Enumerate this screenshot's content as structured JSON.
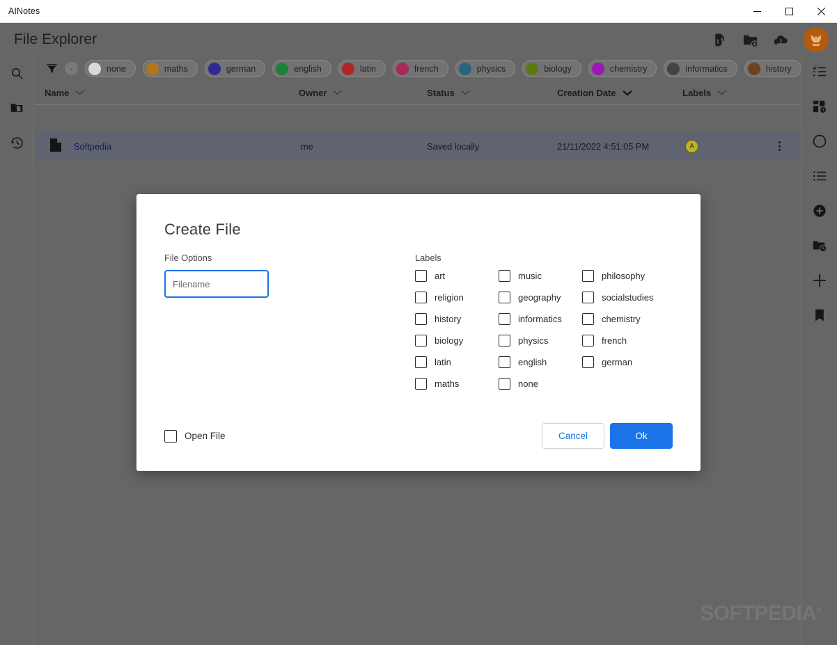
{
  "window": {
    "title": "AINotes",
    "controls": [
      {
        "name": "minimize",
        "glyph": "minimize-icon"
      },
      {
        "name": "maximize",
        "glyph": "maximize-icon"
      },
      {
        "name": "close",
        "glyph": "close-icon"
      }
    ]
  },
  "header": {
    "title": "File Explorer",
    "actions": [
      {
        "name": "new-file-icon",
        "label": "New File"
      },
      {
        "name": "new-folder-icon",
        "label": "New Folder"
      },
      {
        "name": "cloud-alert-icon",
        "label": "Cloud Status"
      }
    ],
    "avatar": {
      "name": "avatar",
      "icon": "cat-icon",
      "color": "#b35c10"
    }
  },
  "left_rail": {
    "items": [
      {
        "name": "search-icon",
        "label": "Search"
      },
      {
        "name": "folder-file-icon",
        "label": "Files"
      },
      {
        "name": "history-clock-icon",
        "label": "History"
      }
    ]
  },
  "right_rail": {
    "items": [
      {
        "name": "checklist-icon",
        "label": "Checklist"
      },
      {
        "name": "dashboard-clock-icon",
        "label": "Recent Boards"
      },
      {
        "name": "circle-icon",
        "label": "Circle"
      },
      {
        "name": "bullet-list-icon",
        "label": "List"
      },
      {
        "name": "add-circle-icon",
        "label": "Add"
      },
      {
        "name": "folder-clock-icon",
        "label": "Recent Folder"
      },
      {
        "name": "plus-icon",
        "label": "New"
      },
      {
        "name": "bookmark-icon",
        "label": "Bookmark"
      }
    ]
  },
  "filterbar": {
    "filter_icon": "filter-icon",
    "scroll_left": "‹",
    "scroll_right": "›",
    "chips": [
      {
        "label": "none",
        "color": "#d9d9d9"
      },
      {
        "label": "maths",
        "color": "#b5751f"
      },
      {
        "label": "german",
        "color": "#302a95"
      },
      {
        "label": "english",
        "color": "#1d8239"
      },
      {
        "label": "latin",
        "color": "#b02525"
      },
      {
        "label": "french",
        "color": "#a8285a"
      },
      {
        "label": "physics",
        "color": "#28647d"
      },
      {
        "label": "biology",
        "color": "#5d7a12"
      },
      {
        "label": "chemistry",
        "color": "#9c16b8"
      },
      {
        "label": "informatics",
        "color": "#3f4444"
      },
      {
        "label": "history",
        "color": "#6b4322"
      }
    ],
    "partial_chip": {
      "label": "",
      "color": "#8fb3c7"
    }
  },
  "table": {
    "columns": [
      {
        "key": "name",
        "label": "Name",
        "sortable": true,
        "active": false
      },
      {
        "key": "owner",
        "label": "Owner",
        "sortable": true,
        "active": false
      },
      {
        "key": "status",
        "label": "Status",
        "sortable": true,
        "active": false
      },
      {
        "key": "created",
        "label": "Creation Date",
        "sortable": true,
        "active": true
      },
      {
        "key": "labels",
        "label": "Labels",
        "sortable": true,
        "active": false
      }
    ],
    "rows": [
      {
        "icon": "file-icon",
        "name": "Softpedia",
        "owner": "me",
        "status": "Saved locally",
        "created": "21/11/2022 4:51:05 PM",
        "label_badge": "A",
        "label_badge_color": "#c2b429",
        "menu": "row-menu-icon"
      }
    ]
  },
  "dialog": {
    "title": "Create File",
    "file_options_label": "File Options",
    "filename_placeholder": "Filename",
    "filename_value": "",
    "labels_label": "Labels",
    "labels": [
      {
        "label": "art",
        "checked": false
      },
      {
        "label": "music",
        "checked": false
      },
      {
        "label": "philosophy",
        "checked": false
      },
      {
        "label": "religion",
        "checked": false
      },
      {
        "label": "geography",
        "checked": false
      },
      {
        "label": "socialstudies",
        "checked": false
      },
      {
        "label": "history",
        "checked": false
      },
      {
        "label": "informatics",
        "checked": false
      },
      {
        "label": "chemistry",
        "checked": false
      },
      {
        "label": "biology",
        "checked": false
      },
      {
        "label": "physics",
        "checked": false
      },
      {
        "label": "french",
        "checked": false
      },
      {
        "label": "latin",
        "checked": false
      },
      {
        "label": "english",
        "checked": false
      },
      {
        "label": "german",
        "checked": false
      },
      {
        "label": "maths",
        "checked": false
      },
      {
        "label": "none",
        "checked": false
      }
    ],
    "open_file_label": "Open File",
    "open_file_checked": false,
    "cancel_label": "Cancel",
    "ok_label": "Ok",
    "accent_color": "#1a73e8"
  },
  "watermark": {
    "text": "SOFTPEDIA",
    "mark": "®"
  }
}
